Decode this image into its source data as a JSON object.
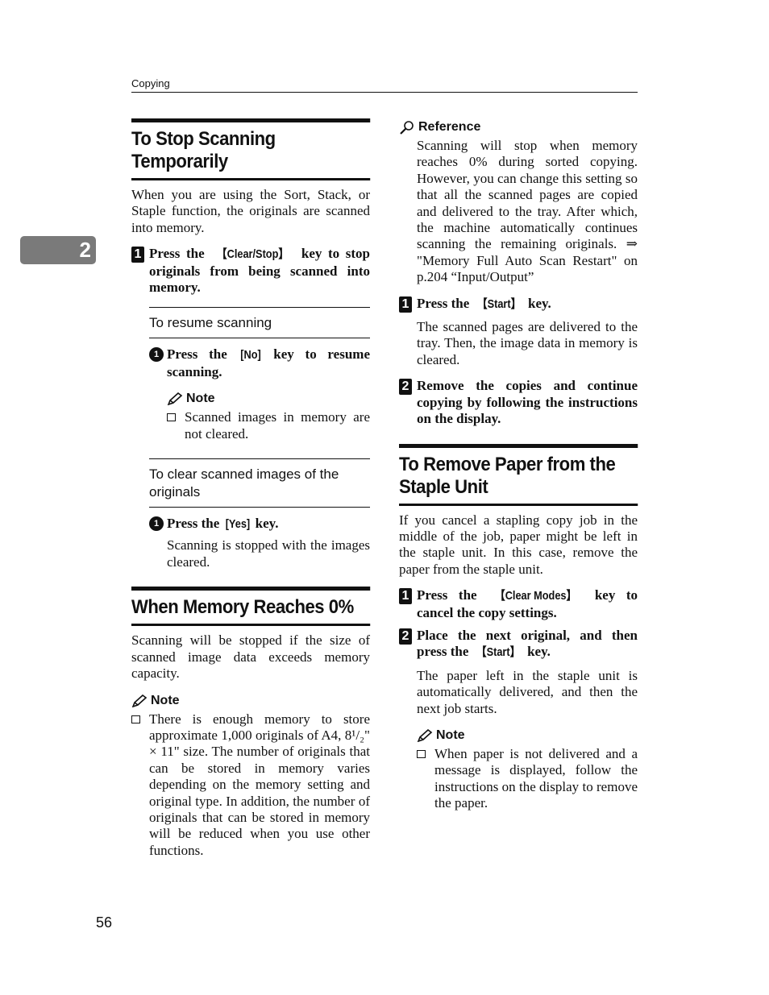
{
  "running_head": "Copying",
  "chapter_tab": "2",
  "page_number": "56",
  "left": {
    "section1": {
      "title": "To Stop Scanning Temporarily",
      "intro": "When you are using the Sort, Stack, or Staple function, the originals are scanned into memory.",
      "step1": {
        "num": "1",
        "pre": "Press the ",
        "key": "【Clear/Stop】",
        "post": " key to stop originals from being scanned into memory."
      },
      "sub1": {
        "title": "To resume scanning",
        "step": {
          "num": "1",
          "pre": "Press the ",
          "key": "[No]",
          "post": " key to resume scanning."
        },
        "note_label": "Note",
        "note": "Scanned images in memory are not cleared."
      },
      "sub2": {
        "title": "To clear scanned images of the originals",
        "step": {
          "num": "1",
          "pre": "Press the ",
          "key": "[Yes]",
          "post": " key."
        },
        "result": "Scanning is stopped with the images cleared."
      }
    },
    "section2": {
      "title": "When Memory Reaches 0%",
      "intro": "Scanning will be stopped if the size of scanned image data exceeds memory capacity.",
      "note_label": "Note",
      "note": "There is enough memory to store approximate 1,000 originals of A4, 8¹/₂\" × 11\" size. The number of originals that can be stored in memory varies depending on the memory setting and original type. In addition, the number of originals that can be stored in memory will be reduced when you use other functions."
    }
  },
  "right": {
    "reference_label": "Reference",
    "reference": "Scanning will stop when memory reaches 0% during sorted copying. However, you can change this setting so that all the scanned pages are copied and delivered to the tray. After which, the machine automatically continues scanning the remaining originals. ⇒ \"Memory Full Auto Scan Restart\" on p.204 “Input/Output”",
    "step1": {
      "num": "1",
      "pre": "Press the ",
      "key": "【Start】",
      "post": " key."
    },
    "step1_result": "The scanned pages are delivered to the tray. Then, the image data in memory is cleared.",
    "step2": {
      "num": "2",
      "text": "Remove the copies and continue copying by following the instructions on the display."
    },
    "section3": {
      "title": "To Remove Paper from the Staple Unit",
      "intro": "If you cancel a stapling copy job in the middle of the job, paper might be left in the staple unit. In this case, remove the paper from the staple unit.",
      "step1": {
        "num": "1",
        "pre": "Press the ",
        "key": "【Clear Modes】",
        "post": " key to cancel the copy settings."
      },
      "step2": {
        "num": "2",
        "pre": "Place the next original, and then press the ",
        "key": "【Start】",
        "post": " key."
      },
      "step2_result": "The paper left in the staple unit is automatically delivered, and then the next job starts.",
      "note_label": "Note",
      "note": "When paper is not delivered and a message is displayed, follow the instructions on the display to remove the paper."
    }
  }
}
